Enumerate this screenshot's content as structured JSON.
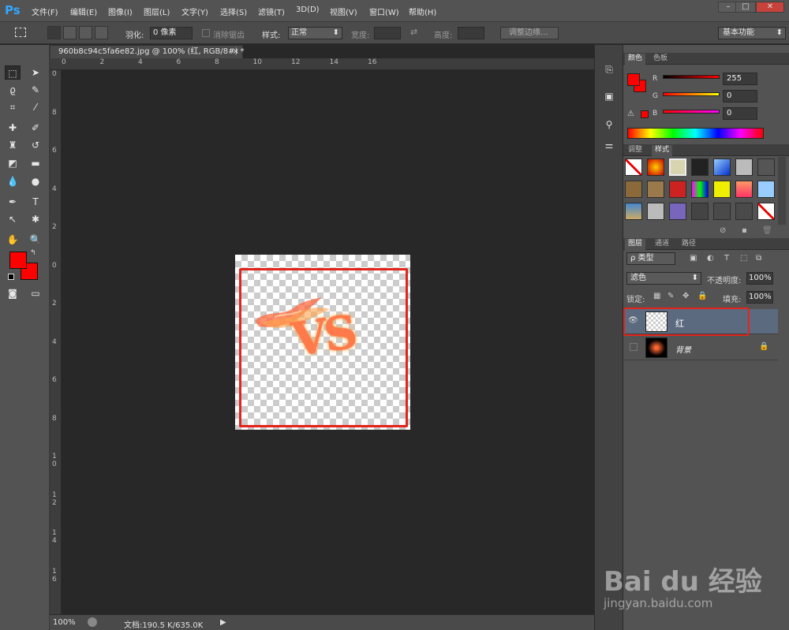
{
  "app": {
    "logo": "Ps",
    "menu": [
      "文件(F)",
      "编辑(E)",
      "图像(I)",
      "图层(L)",
      "文字(Y)",
      "选择(S)",
      "滤镜(T)",
      "3D(D)",
      "视图(V)",
      "窗口(W)",
      "帮助(H)"
    ],
    "window_controls": [
      "–",
      "□",
      "✕"
    ]
  },
  "options": {
    "feather_label": "羽化:",
    "feather_value": "0 像素",
    "antialias_label": "消除锯齿",
    "style_label": "样式:",
    "style_value": "正常",
    "width_label": "宽度:",
    "height_label": "高度:",
    "refine_edge_button": "调整边缘...",
    "workspace": "基本功能"
  },
  "document": {
    "tab_title": "960b8c94c5fa6e82.jpg @ 100% (红, RGB/8#) *",
    "ruler_h": [
      "0",
      "2",
      "4",
      "6",
      "8",
      "10",
      "12",
      "14",
      "16"
    ],
    "ruler_v": [
      "0",
      "8",
      "6",
      "4",
      "2",
      "0",
      "2",
      "4",
      "6",
      "8",
      "1 0",
      "1 2",
      "1 4",
      "1 6"
    ],
    "canvas_art_text": "VS",
    "zoom": "100%",
    "doc_info": "文档:190.5 K/635.0K"
  },
  "color_panel": {
    "tabs": [
      "颜色",
      "色板"
    ],
    "channels": [
      {
        "label": "R",
        "value": "255"
      },
      {
        "label": "G",
        "value": "0"
      },
      {
        "label": "B",
        "value": "0"
      }
    ],
    "foreground_color": "#ff0000"
  },
  "styles_panel": {
    "tabs": [
      "调整",
      "样式"
    ]
  },
  "layers_panel": {
    "tabs": [
      "图层",
      "通道",
      "路径"
    ],
    "filter_kind": "ρ 类型",
    "blend_mode": "滤色",
    "opacity_label": "不透明度:",
    "opacity_value": "100%",
    "lock_label": "锁定:",
    "fill_label": "填充:",
    "fill_value": "100%",
    "layers": [
      {
        "name": "红",
        "visible": true,
        "selected": true,
        "locked": false
      },
      {
        "name": "背景",
        "visible": false,
        "selected": false,
        "locked": true
      }
    ]
  },
  "watermark": {
    "brand": "Bai du 经验",
    "url": "jingyan.baidu.com"
  }
}
